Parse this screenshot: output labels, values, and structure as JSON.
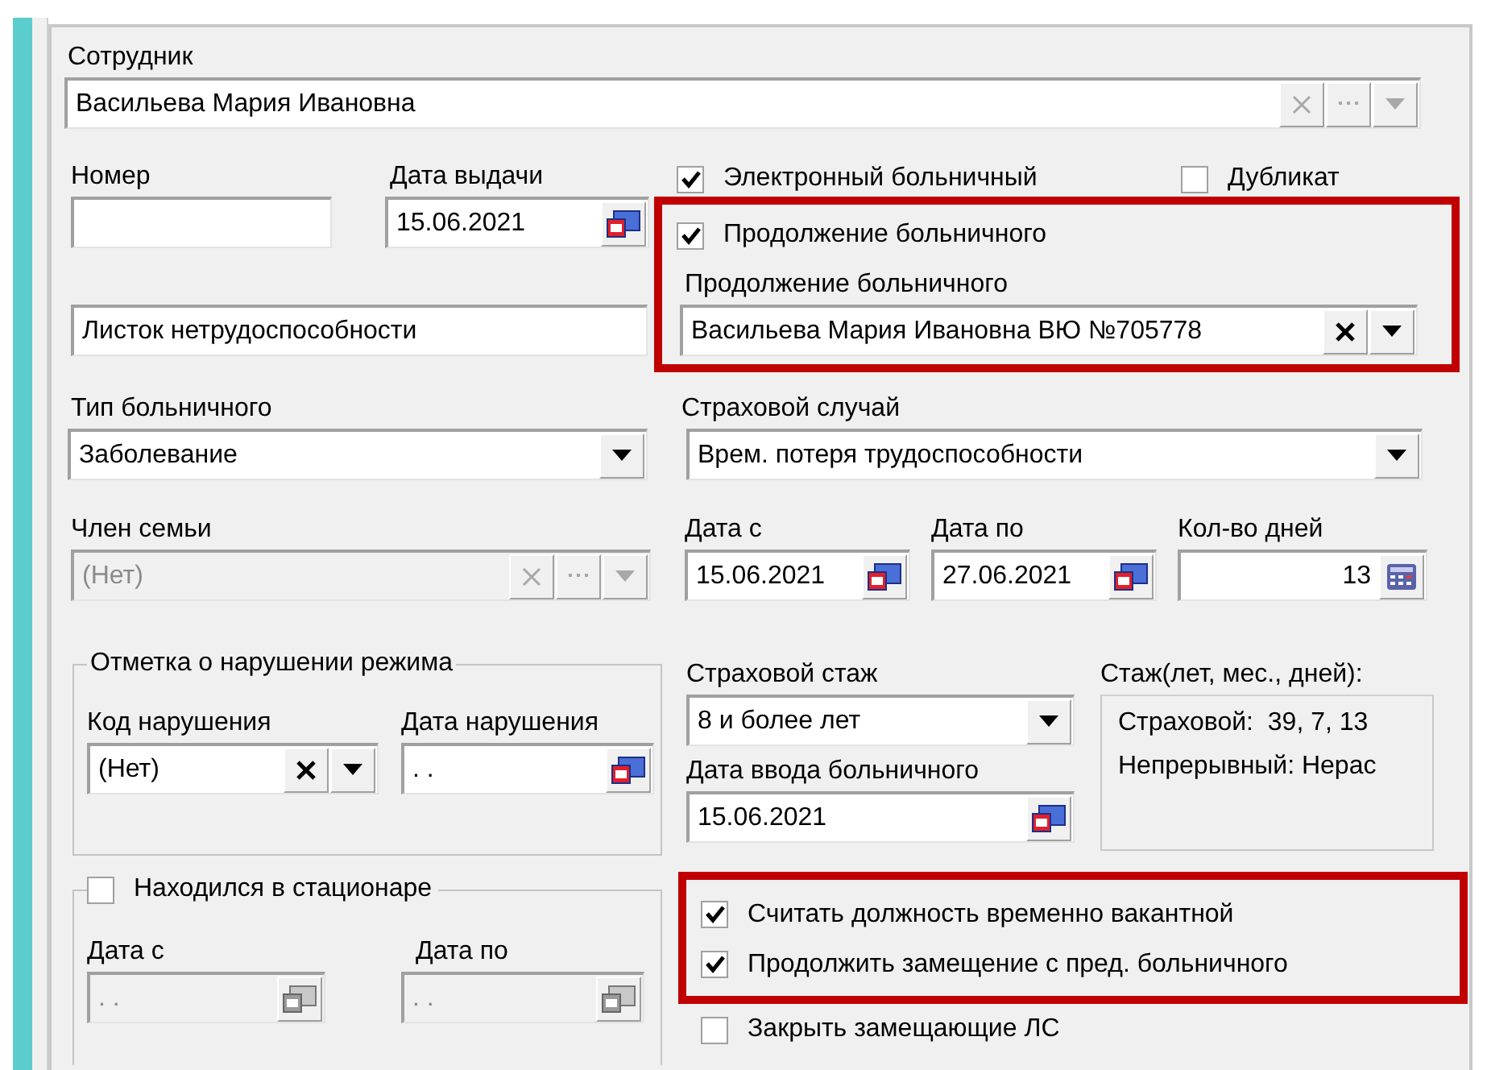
{
  "employee": {
    "label": "Сотрудник",
    "value": "Васильева Мария Ивановна",
    "buttons": [
      {
        "kind": "clear"
      },
      {
        "kind": "more"
      },
      {
        "kind": "dropdown"
      }
    ],
    "buttons_disabled": true
  },
  "number": {
    "label": "Номер"
  },
  "issue_date": {
    "label": "Дата выдачи",
    "value": "15.06.2021",
    "kind": "calendar"
  },
  "flags": [
    {
      "label": "Электронный больничный",
      "checked": true
    },
    {
      "label": "Дубликат",
      "checked": false
    }
  ],
  "continuation": {
    "highlighted": true,
    "checkbox": {
      "label": "Продолжение больничного",
      "checked": true
    },
    "label": "Продолжение больничного",
    "value": "Васильева Мария Ивановна ВЮ №705778",
    "buttons": [
      {
        "kind": "clear"
      },
      {
        "kind": "dropdown"
      }
    ]
  },
  "document_type": {
    "value": "Листок нетрудоспособности"
  },
  "sick_type": {
    "label": "Тип больничного",
    "value": "Заболевание",
    "buttons": [
      {
        "kind": "dropdown"
      }
    ]
  },
  "insurance_case": {
    "label": "Страховой случай",
    "value": "Врем. потеря трудоспособности",
    "buttons": [
      {
        "kind": "dropdown"
      }
    ]
  },
  "family_member": {
    "label": "Член семьи",
    "value": "(Нет)",
    "buttons": [
      {
        "kind": "clear"
      },
      {
        "kind": "more"
      },
      {
        "kind": "dropdown"
      }
    ],
    "disabled": true
  },
  "period": [
    {
      "label": "Дата с",
      "value": "15.06.2021",
      "kind": "calendar"
    },
    {
      "label": "Дата по",
      "value": "27.06.2021",
      "kind": "calendar"
    },
    {
      "label": "Кол-во дней",
      "value": "13",
      "kind": "calculator"
    }
  ],
  "violation": {
    "title": "Отметка о нарушении режима",
    "code": {
      "label": "Код нарушения",
      "value": "(Нет)",
      "buttons": [
        {
          "kind": "clear"
        },
        {
          "kind": "dropdown"
        }
      ]
    },
    "date": {
      "label": "Дата нарушения",
      "value": ". .",
      "kind": "calendar"
    }
  },
  "insurance_stage": {
    "label": "Страховой стаж",
    "value": "8 и более лет",
    "buttons": [
      {
        "kind": "dropdown"
      }
    ]
  },
  "entry_date": {
    "label": "Дата ввода больничного",
    "value": "15.06.2021",
    "kind": "calendar"
  },
  "stage_info": {
    "label": "Стаж(лет, мес., дней):",
    "lines": [
      "Страховой:  39, 7, 13",
      "Непрерывный: Нерас"
    ]
  },
  "hospital": {
    "checkbox": {
      "label": "Находился в стационаре",
      "checked": false
    },
    "dates": [
      {
        "label": "Дата с",
        "value": ". .",
        "kind": "calendar",
        "disabled": true
      },
      {
        "label": "Дата по",
        "value": ". .",
        "kind": "calendar",
        "disabled": true
      }
    ]
  },
  "substitution": {
    "highlighted": true,
    "items": [
      {
        "label": "Считать должность временно вакантной",
        "checked": true
      },
      {
        "label": "Продолжить замещение с пред. больничного",
        "checked": true
      }
    ]
  },
  "close_substitutes": {
    "label": "Закрыть замещающие ЛС",
    "checked": false
  }
}
